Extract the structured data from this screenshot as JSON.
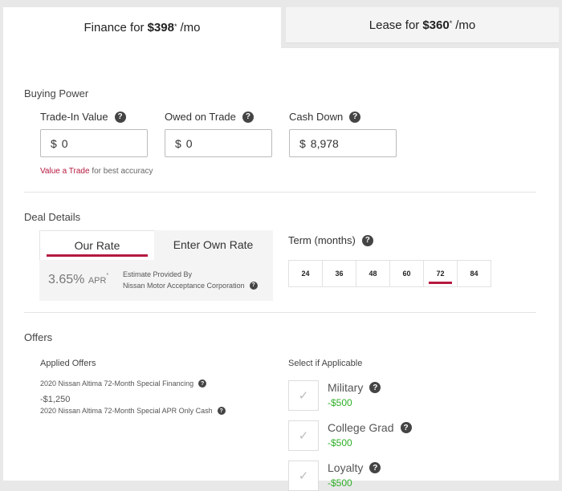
{
  "tabs": {
    "finance": {
      "prefix": "Finance for",
      "amount": "$398",
      "mark": "*",
      "suffix": "/mo"
    },
    "lease": {
      "prefix": "Lease for",
      "amount": "$360",
      "mark": "*",
      "suffix": "/mo"
    }
  },
  "buying_power": {
    "title": "Buying Power",
    "trade_in": {
      "label": "Trade-In Value",
      "currency": "$",
      "value": "0"
    },
    "owed": {
      "label": "Owed on Trade",
      "currency": "$",
      "value": "0"
    },
    "cash_down": {
      "label": "Cash Down",
      "currency": "$",
      "value": "8,978"
    },
    "note_link": "Value a Trade",
    "note_text": "for best accuracy"
  },
  "deal_details": {
    "title": "Deal Details",
    "our_rate_tab": "Our Rate",
    "own_rate_tab": "Enter Own Rate",
    "apr_value": "3.65%",
    "apr_label": "APR",
    "apr_mark": "*",
    "estimate_line1": "Estimate Provided By",
    "estimate_line2": "Nissan Motor Acceptance Corporation",
    "term_label": "Term (months)",
    "terms": [
      "24",
      "36",
      "48",
      "60",
      "72",
      "84"
    ],
    "selected_term": "72"
  },
  "offers": {
    "title": "Offers",
    "applied_title": "Applied Offers",
    "applied": [
      {
        "name": "2020 Nissan Altima 72-Month Special Financing"
      },
      {
        "amount": "-$1,250",
        "name": "2020 Nissan Altima 72-Month Special APR Only Cash"
      }
    ],
    "select_title": "Select if Applicable",
    "options": [
      {
        "label": "Military",
        "amount": "-$500"
      },
      {
        "label": "College Grad",
        "amount": "-$500"
      },
      {
        "label": "Loyalty",
        "amount": "-$500"
      }
    ]
  },
  "icons": {
    "help": "question-circle-icon",
    "check": "check-icon"
  },
  "colors": {
    "accent": "#b5193f",
    "discount": "#2fae27"
  }
}
